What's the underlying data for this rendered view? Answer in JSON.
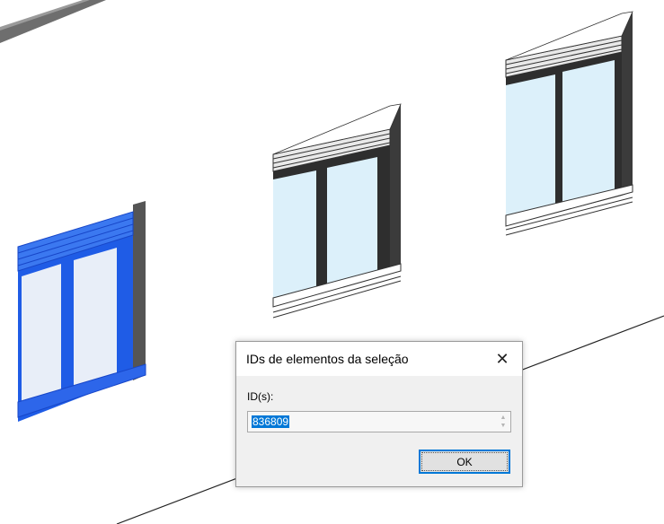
{
  "dialog": {
    "title": "IDs de elementos da seleção",
    "field_label": "ID(s):",
    "field_value": "836809",
    "ok_label": "OK",
    "close_glyph": "✕"
  },
  "icons": [
    "close-icon",
    "spin-up-icon",
    "spin-down-icon"
  ],
  "colors": {
    "selection": "#1f5ce6",
    "glass": "#dcf0fa",
    "frame": "#3a3a3a",
    "accent": "#0078d7"
  }
}
